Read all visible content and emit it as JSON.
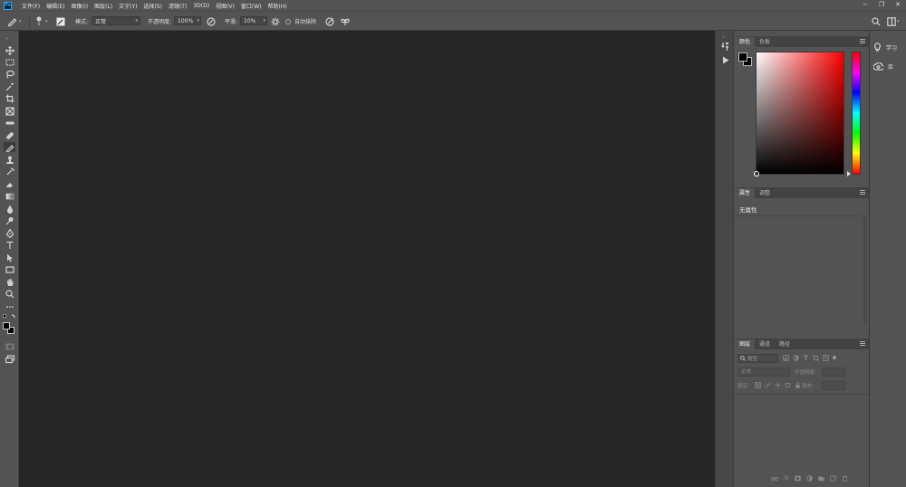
{
  "menubar": {
    "logo": "Ps",
    "items": [
      "文件(F)",
      "编辑(E)",
      "图像(I)",
      "图层(L)",
      "文字(Y)",
      "选择(S)",
      "滤镜(T)",
      "3D(D)",
      "视图(V)",
      "窗口(W)",
      "帮助(H)"
    ],
    "window_controls": [
      "−",
      "❐",
      "✕"
    ]
  },
  "options": {
    "mode_label": "模式:",
    "mode_value": "正常",
    "opacity_label": "不透明度:",
    "opacity_value": "100%",
    "smooth_label": "平滑:",
    "smooth_value": "10%",
    "auto_erase_label": "自动抹除"
  },
  "color_panel": {
    "tabs": [
      "颜色",
      "色板"
    ],
    "hue_color": "#ff0000"
  },
  "properties_panel": {
    "tabs": [
      "属性",
      "调整"
    ],
    "empty_text": "无属性"
  },
  "layers_panel": {
    "tabs": [
      "图层",
      "通道",
      "路径"
    ],
    "filter_placeholder": "类型",
    "blend_mode": "正常",
    "opacity_label": "不透明度:",
    "lock_label": "锁定:",
    "fill_label": "填充:"
  },
  "right_dock": {
    "items": [
      {
        "label": "学习",
        "icon": "lightbulb-icon"
      },
      {
        "label": "库",
        "icon": "libraries-icon"
      }
    ]
  },
  "colors": {
    "app_bg": "#535353",
    "canvas_bg": "#262626",
    "foreground": "#000000",
    "background": "#000000"
  }
}
